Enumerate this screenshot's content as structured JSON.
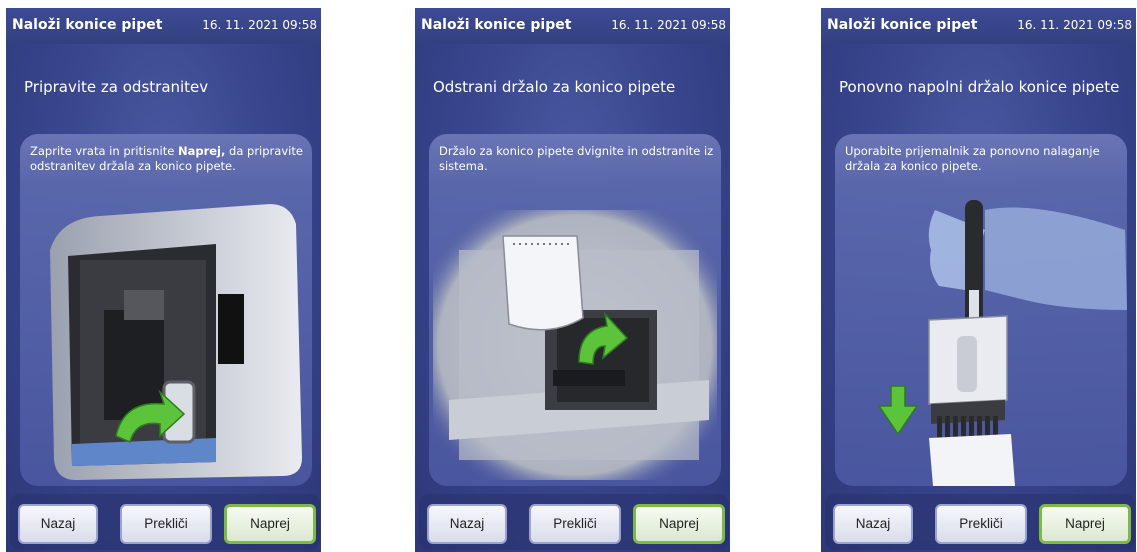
{
  "screens": [
    {
      "header": {
        "title": "Naloži konice pipet",
        "datetime": "16. 11. 2021 09:58"
      },
      "step_title": "Pripravite za odstranitev",
      "instruction": {
        "before": "Zaprite vrata in pritisnite ",
        "bold": "Naprej,",
        "after": " da pripravite odstranitev držala za konico pipete."
      },
      "buttons": {
        "back": "Nazaj",
        "cancel": "Prekliči",
        "next": "Naprej"
      }
    },
    {
      "header": {
        "title": "Naloži konice pipet",
        "datetime": "16. 11. 2021 09:58"
      },
      "step_title": "Odstrani držalo za konico pipete",
      "instruction": {
        "text": "Držalo za konico pipete dvignite in odstranite iz sistema."
      },
      "buttons": {
        "back": "Nazaj",
        "cancel": "Prekliči",
        "next": "Naprej"
      }
    },
    {
      "header": {
        "title": "Naloži konice pipet",
        "datetime": "16. 11. 2021 09:58"
      },
      "step_title": "Ponovno napolni držalo konice pipete",
      "instruction": {
        "text": "Uporabite prijemalnik za ponovno nalaganje držala za konico pipete."
      },
      "buttons": {
        "back": "Nazaj",
        "cancel": "Prekliči",
        "next": "Naprej"
      }
    }
  ],
  "colors": {
    "background": "#3a478f",
    "next_border": "#7fb84a",
    "arrow": "#5cc43a"
  }
}
